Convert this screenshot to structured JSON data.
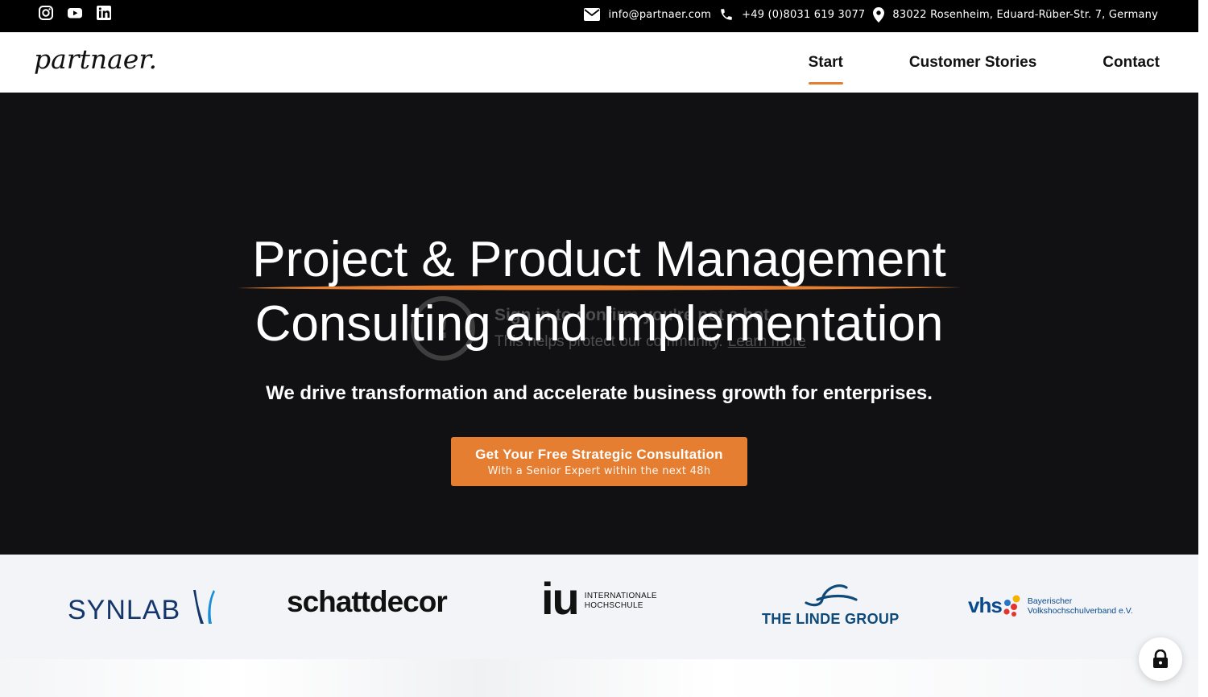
{
  "topbar": {
    "social": [
      {
        "name": "instagram-icon"
      },
      {
        "name": "youtube-icon"
      },
      {
        "name": "linkedin-icon"
      }
    ],
    "email": "info@partnaer.com",
    "phone": "+49 (0)8031 619 3077",
    "address": "83022 Rosenheim, Eduard-Rüber-Str. 7, Germany"
  },
  "header": {
    "logo_text": "partnaer.",
    "nav": [
      {
        "label": "Start",
        "active": true
      },
      {
        "label": "Customer Stories",
        "active": false
      },
      {
        "label": "Contact",
        "active": false
      }
    ]
  },
  "hero": {
    "headline_line1": "Project & Product Management",
    "headline_line2": "Consulting and Implementation",
    "subheadline": "We drive transformation and accelerate business growth for enterprises.",
    "cta_title": "Get Your Free Strategic Consultation",
    "cta_subtitle": "With a Senior Expert within the next 48h",
    "overlay_title": "Sign in to confirm you're not a bot",
    "overlay_text": "This helps protect our community.",
    "overlay_link": "Learn more"
  },
  "logos": {
    "synlab": "SYNLAB",
    "schattdecor": "schattdecor",
    "iu_mark": "iu",
    "iu_line1": "INTERNATIONALE",
    "iu_line2": "HOCHSCHULE",
    "linde": "THE LINDE GROUP",
    "vhs_mark": "vhs",
    "vhs_line1": "Bayerischer",
    "vhs_line2": "Volkshochschulverband e.V."
  },
  "colors": {
    "accent": "#e57e31",
    "topbar_bg": "#000000",
    "hero_bg": "#111113",
    "logos_bg": "#f2f4f7"
  }
}
